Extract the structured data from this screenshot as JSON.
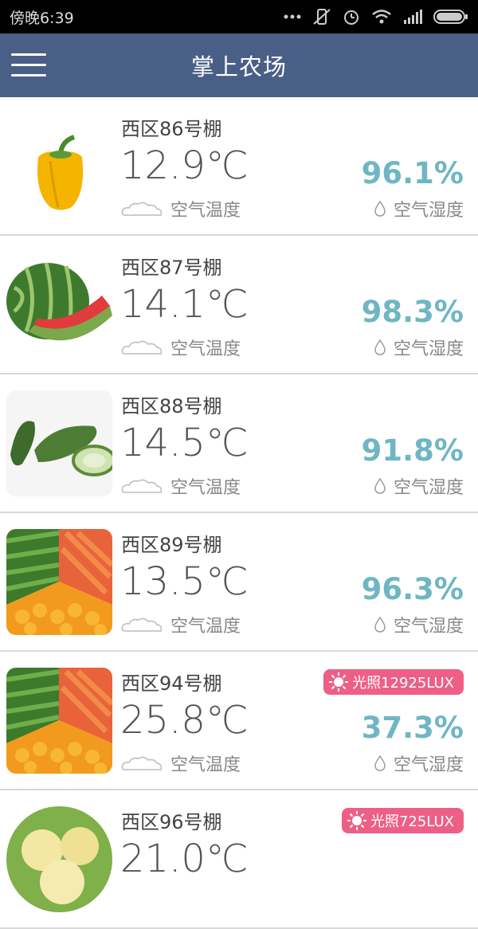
{
  "status": {
    "time": "傍晚6:39"
  },
  "app": {
    "title": "掌上农场"
  },
  "labels": {
    "temp": "空气温度",
    "humidity": "空气湿度"
  },
  "rows": [
    {
      "name": "西区86号棚",
      "temp": "12.9℃",
      "humidity": "96.1%",
      "lux": "",
      "thumb": "pepper"
    },
    {
      "name": "西区87号棚",
      "temp": "14.1℃",
      "humidity": "98.3%",
      "lux": "",
      "thumb": "watermelon"
    },
    {
      "name": "西区88号棚",
      "temp": "14.5℃",
      "humidity": "91.8%",
      "lux": "",
      "thumb": "cucumber"
    },
    {
      "name": "西区89号棚",
      "temp": "13.5℃",
      "humidity": "96.3%",
      "lux": "",
      "thumb": "veg-mix"
    },
    {
      "name": "西区94号棚",
      "temp": "25.8℃",
      "humidity": "37.3%",
      "lux": "光照12925LUX",
      "thumb": "veg-mix"
    },
    {
      "name": "西区96号棚",
      "temp": "21.0℃",
      "humidity": "",
      "lux": "光照725LUX",
      "thumb": "fruit"
    }
  ],
  "colors": {
    "appbar": "#4a5f86",
    "humidity": "#6fb6c4",
    "lux_badge": "#ee5f86"
  }
}
